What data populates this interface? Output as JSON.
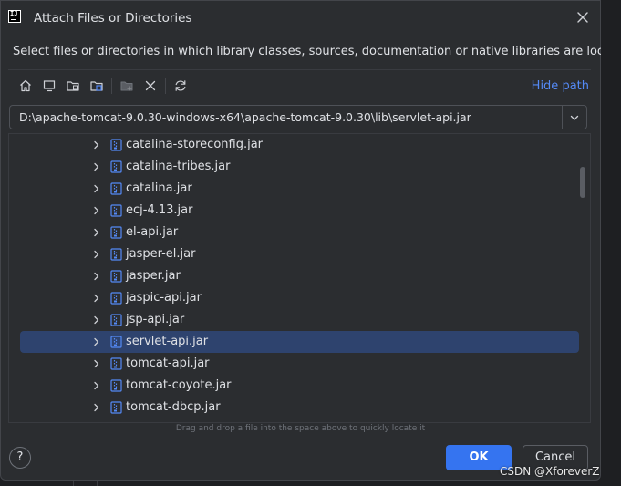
{
  "dialog": {
    "title": "Attach Files or Directories",
    "description": "Select files or directories in which library classes, sources, documentation or native libraries are located"
  },
  "toolbar": {
    "icons": [
      "home-icon",
      "desktop-icon",
      "project-folder-icon",
      "module-folder-icon",
      "new-folder-icon",
      "delete-icon",
      "refresh-icon"
    ],
    "hide_path_label": "Hide path"
  },
  "path": {
    "value": "D:\\apache-tomcat-9.0.30-windows-x64\\apache-tomcat-9.0.30\\lib\\servlet-api.jar"
  },
  "tree": {
    "items": [
      {
        "label": "catalina-storeconfig.jar"
      },
      {
        "label": "catalina-tribes.jar"
      },
      {
        "label": "catalina.jar"
      },
      {
        "label": "ecj-4.13.jar"
      },
      {
        "label": "el-api.jar"
      },
      {
        "label": "jasper-el.jar"
      },
      {
        "label": "jasper.jar"
      },
      {
        "label": "jaspic-api.jar"
      },
      {
        "label": "jsp-api.jar"
      },
      {
        "label": "servlet-api.jar"
      },
      {
        "label": "tomcat-api.jar"
      },
      {
        "label": "tomcat-coyote.jar"
      },
      {
        "label": "tomcat-dbcp.jar"
      }
    ],
    "selected": "servlet-api.jar"
  },
  "hint": "Drag and drop a file into the space above to quickly locate it",
  "buttons": {
    "help": "?",
    "ok": "OK",
    "cancel": "Cancel"
  },
  "watermark": "CSDN @XforeverZ",
  "colors": {
    "accent": "#3574f0",
    "link": "#548af7",
    "selection": "#2e436e",
    "background": "#2b2d30",
    "jar_icon": "#548af7"
  }
}
